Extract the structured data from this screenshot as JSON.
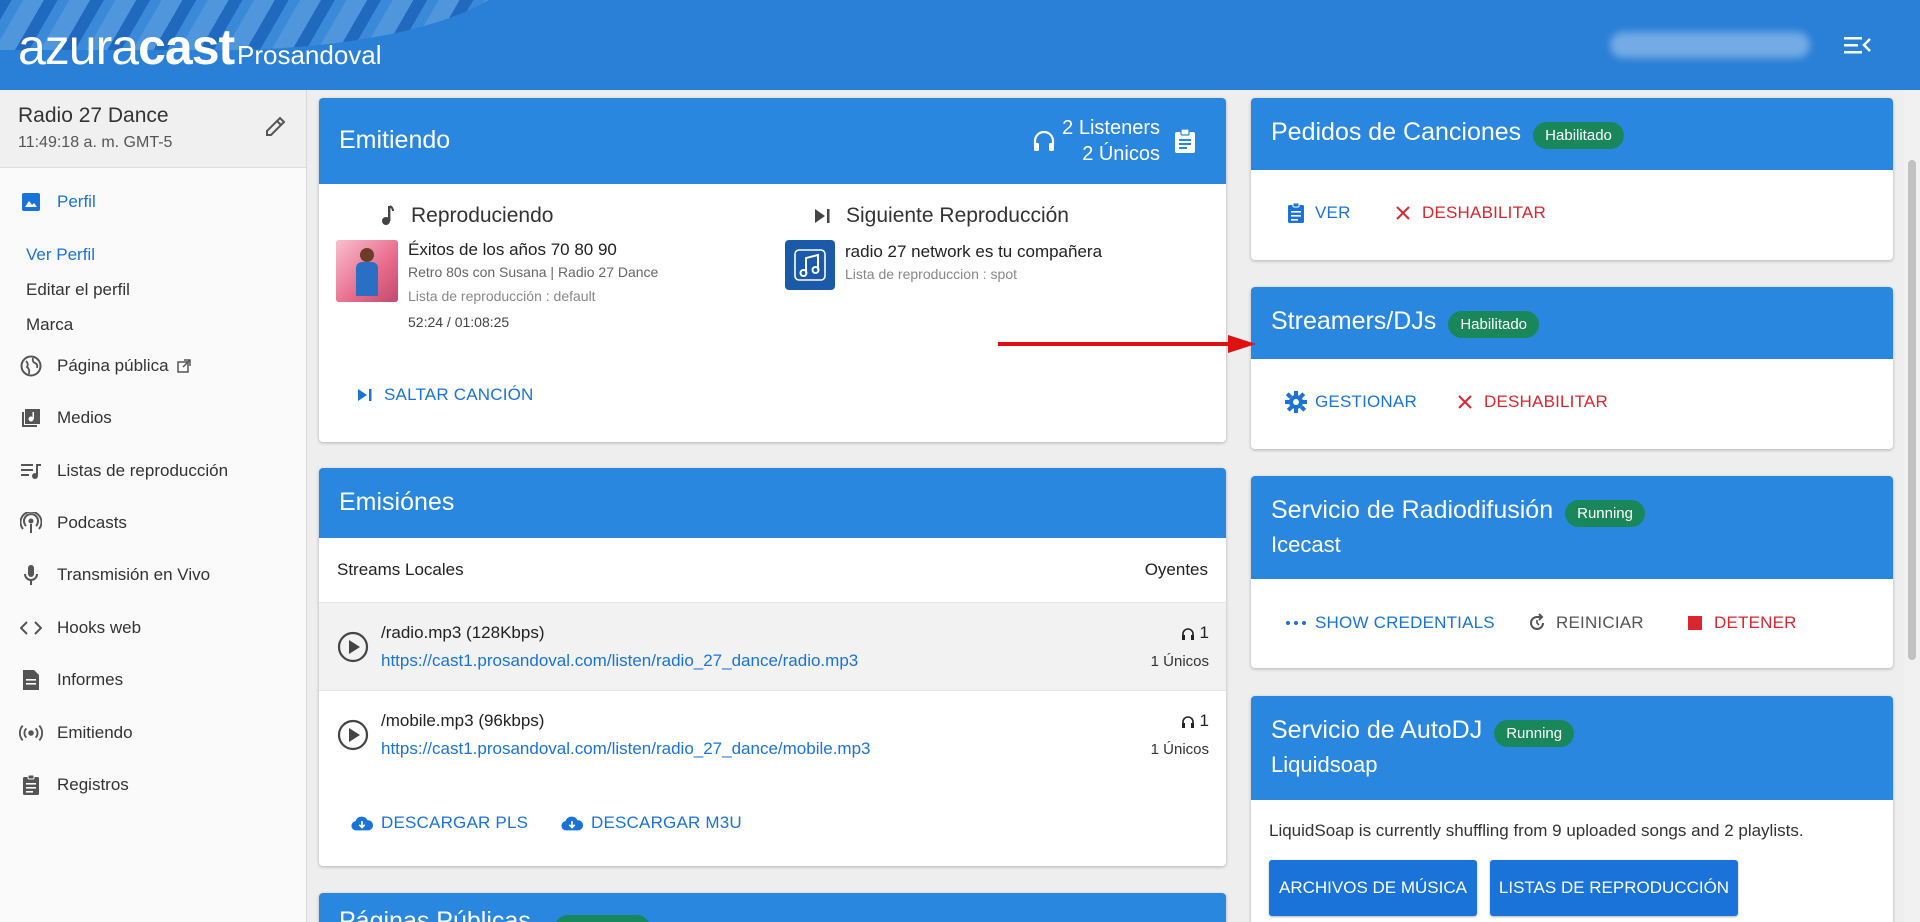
{
  "header": {
    "brand_light": "azura",
    "brand_bold": "cast",
    "station": "Prosandoval"
  },
  "sidebar": {
    "station_name": "Radio 27 Dance",
    "station_time": "11:49:18 a. m. GMT-5",
    "items": [
      {
        "label": "Perfil",
        "icon": "image-icon"
      },
      {
        "label": "Página pública",
        "icon": "globe-icon"
      },
      {
        "label": "Medios",
        "icon": "music-library-icon"
      },
      {
        "label": "Listas de reproducción",
        "icon": "playlist-icon"
      },
      {
        "label": "Podcasts",
        "icon": "podcast-icon"
      },
      {
        "label": "Transmisión en Vivo",
        "icon": "mic-icon"
      },
      {
        "label": "Hooks web",
        "icon": "code-icon"
      },
      {
        "label": "Informes",
        "icon": "report-icon"
      },
      {
        "label": "Emitiendo",
        "icon": "broadcast-icon"
      },
      {
        "label": "Registros",
        "icon": "clipboard-icon"
      }
    ],
    "sub_items": [
      "Ver Perfil",
      "Editar el perfil",
      "Marca"
    ]
  },
  "now_playing": {
    "title": "Emitiendo",
    "listeners": "2 Listeners",
    "uniques": "2  Únicos",
    "playing_label": "Reproduciendo",
    "next_label": "Siguiente Reproducción",
    "song_title": "Éxitos de los años 70 80 90",
    "song_artist": "Retro 80s con Susana | Radio 27 Dance",
    "song_playlist": "Lista de reproducción : default",
    "song_time": "52:24 / 01:08:25",
    "next_title": "radio 27 network es tu compañera",
    "next_playlist": "Lista de reproduccion : spot",
    "skip_label": "SALTAR CANCIÓN"
  },
  "streams": {
    "title": "Emisiónes",
    "col_streams": "Streams Locales",
    "col_listeners": "Oyentes",
    "rows": [
      {
        "name": "/radio.mp3 (128Kbps)",
        "url": "https://cast1.prosandoval.com/listen/radio_27_dance/radio.mp3",
        "count": "1",
        "uniques": "1  Únicos"
      },
      {
        "name": "/mobile.mp3 (96kbps)",
        "url": "https://cast1.prosandoval.com/listen/radio_27_dance/mobile.mp3",
        "count": "1",
        "uniques": "1  Únicos"
      }
    ],
    "download_pls": "DESCARGAR PLS",
    "download_m3u": "DESCARGAR M3U"
  },
  "public_pages": {
    "title": "Páginas Públicas"
  },
  "requests": {
    "title": "Pedidos de Canciones",
    "badge": "Habilitado",
    "view": "VER",
    "disable": "DESHABILITAR"
  },
  "streamers": {
    "title": "Streamers/DJs",
    "badge": "Habilitado",
    "manage": "GESTIONAR",
    "disable": "DESHABILITAR"
  },
  "broadcast_service": {
    "title": "Servicio de Radiodifusión",
    "badge": "Running",
    "subtitle": "Icecast",
    "credentials": "SHOW CREDENTIALS",
    "restart": "REINICIAR",
    "stop": "DETENER"
  },
  "autodj": {
    "title": "Servicio de AutoDJ",
    "badge": "Running",
    "subtitle": "Liquidsoap",
    "description": "LiquidSoap is currently shuffling from 9 uploaded songs and 2 playlists.",
    "music_files": "ARCHIVOS DE MÚSICA",
    "playlists": "LISTAS DE REPRODUCCIÓN"
  },
  "colors": {
    "primary": "#2a87e0",
    "link": "#1a73d9",
    "danger": "#d9262f",
    "success_badge": "#19875a",
    "annotation_arrow": "#e01010"
  }
}
